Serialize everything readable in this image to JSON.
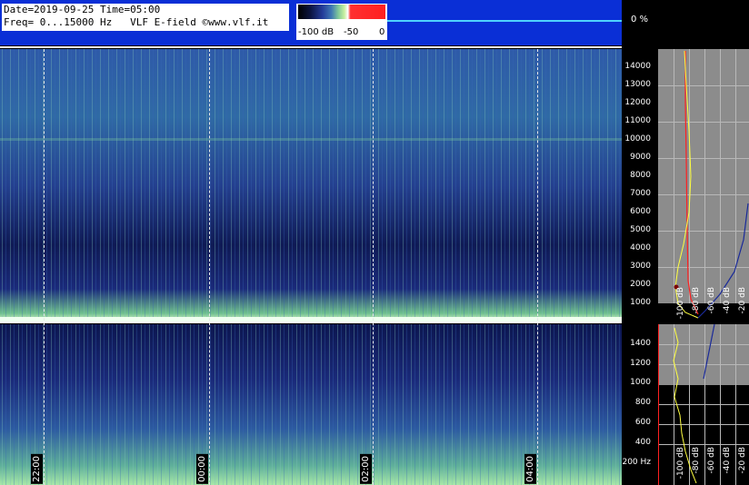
{
  "header": {
    "date_line": "Date=2019-09-25 Time=05:00",
    "freq_line": "Freq= 0...15000 Hz   VLF E-field ©www.vlf.it",
    "percent": "0 %"
  },
  "colorbar": {
    "labels": [
      "-100 dB",
      "-50",
      "0"
    ]
  },
  "time_axis": {
    "labels": [
      "22:00",
      "00:00",
      "02:00",
      "04:00"
    ]
  },
  "freq_axis_top": {
    "ticks": [
      "14000",
      "13000",
      "12000",
      "11000",
      "10000",
      "9000",
      "8000",
      "7000",
      "6000",
      "5000",
      "4000",
      "3000",
      "2000",
      "1000"
    ]
  },
  "freq_axis_bottom": {
    "ticks": [
      "1400",
      "1200",
      "1000",
      "800",
      "600",
      "400",
      "200 Hz"
    ]
  },
  "profile_top": {
    "db_labels": [
      "-100 dB",
      "-80 dB",
      "-60 dB",
      "-40 dB",
      "-20 dB"
    ]
  },
  "profile_bottom": {
    "db_labels": [
      "-100 dB",
      "-80 dB",
      "-60 dB",
      "-40 dB",
      "-20 dB"
    ]
  },
  "colors": {
    "header_bg": "#0a2fd6",
    "profile_yellow": "#ffff40",
    "profile_red": "#ff2020",
    "profile_blue": "#1a2a9a"
  }
}
